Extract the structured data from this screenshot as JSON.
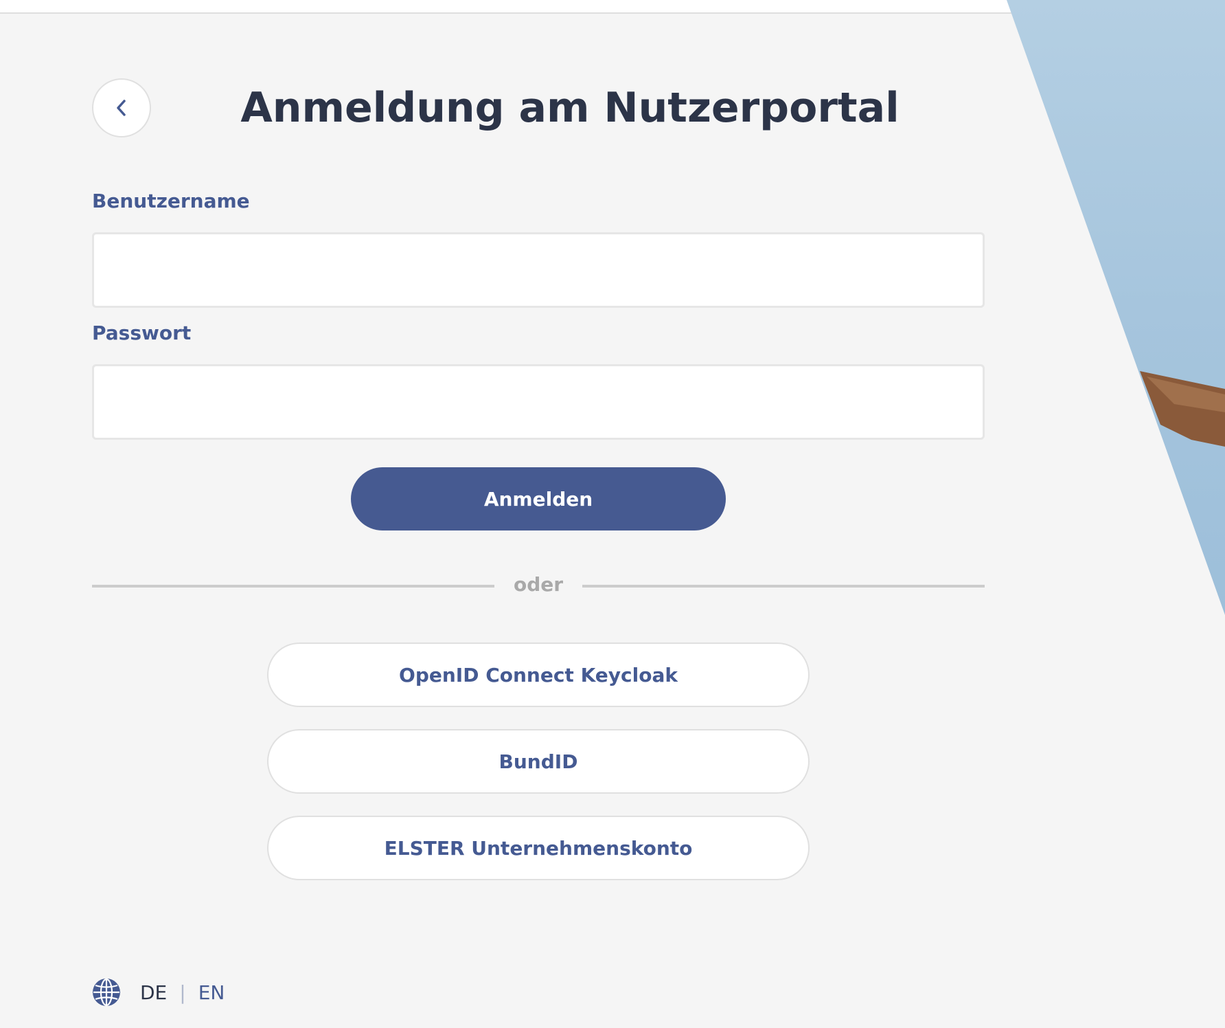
{
  "page": {
    "title": "Anmeldung am Nutzerportal"
  },
  "form": {
    "username_label": "Benutzername",
    "username_value": "",
    "password_label": "Passwort",
    "password_value": "",
    "submit_label": "Anmelden"
  },
  "divider": {
    "text": "oder"
  },
  "providers": [
    {
      "label": "OpenID Connect Keycloak"
    },
    {
      "label": "BundID"
    },
    {
      "label": "ELSTER Unternehmenskonto"
    }
  ],
  "language": {
    "icon": "globe-icon",
    "options": [
      "DE",
      "EN"
    ],
    "selected": "DE",
    "separator": "|"
  },
  "icons": {
    "back": "chevron-left-icon"
  },
  "colors": {
    "primary": "#465a91",
    "label": "#455a92",
    "title": "#2c3448",
    "background": "#f5f5f5",
    "divider": "#cccccc",
    "divider_text": "#a9a9a9"
  }
}
